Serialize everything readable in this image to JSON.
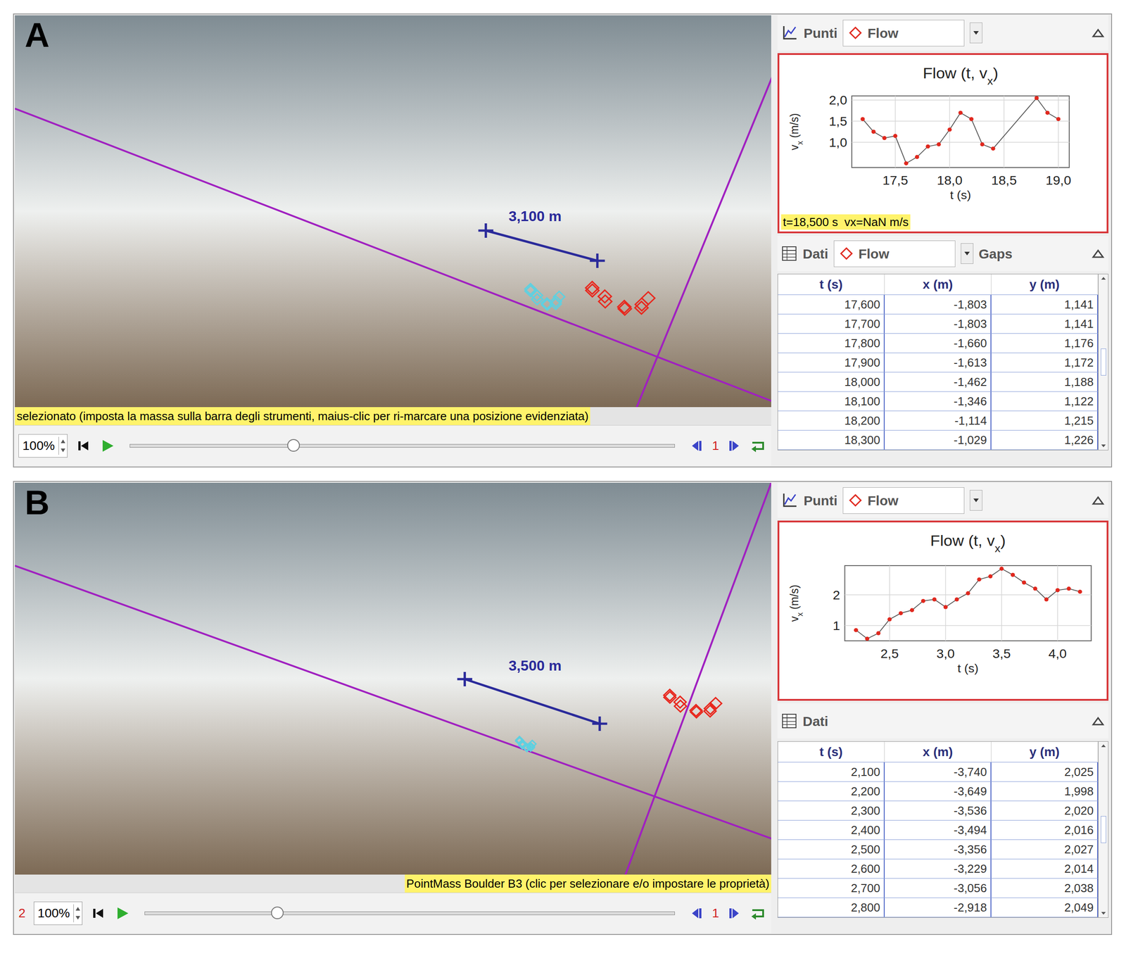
{
  "panels": [
    {
      "letter": "A",
      "video": {
        "tape_label": "3,100 m",
        "status": "selezionato (imposta la massa sulla barra degli strumenti, maius-clic per ri-marcare una posizione evidenziata)"
      },
      "controls": {
        "zoom": "100%",
        "frame": "1",
        "level": 0.3
      },
      "plot": {
        "view": "Punti",
        "track": "Flow",
        "title": "Flow (t, v",
        "title_sub": "x",
        "title_end": ")",
        "y_label": "v",
        "y_label_sub": "x",
        "y_label_end": " (m/s)",
        "x_label": "t (s)",
        "x_ticks": [
          {
            "label": "17,5",
            "value": 17.5
          },
          {
            "label": "18,0",
            "value": 18.0
          },
          {
            "label": "18,5",
            "value": 18.5
          },
          {
            "label": "19,0",
            "value": 19.0
          }
        ],
        "y_ticks": [
          {
            "label": "2,0",
            "value": 2.0
          },
          {
            "label": "1,5",
            "value": 1.5
          },
          {
            "label": "1,0",
            "value": 1.0
          }
        ],
        "series": [
          {
            "name": "Flow",
            "points": [
              [
                17.2,
                1.55
              ],
              [
                17.3,
                1.25
              ],
              [
                17.4,
                1.1
              ],
              [
                17.5,
                1.15
              ],
              [
                17.6,
                0.5
              ],
              [
                17.7,
                0.65
              ],
              [
                17.8,
                0.9
              ],
              [
                17.9,
                0.95
              ],
              [
                18.0,
                1.3
              ],
              [
                18.1,
                1.7
              ],
              [
                18.2,
                1.55
              ],
              [
                18.3,
                0.95
              ],
              [
                18.4,
                0.85
              ],
              [
                18.8,
                2.05
              ],
              [
                18.9,
                1.7
              ],
              [
                19.0,
                1.55
              ]
            ]
          }
        ],
        "readout": "t=18,500 s  vx=NaN m/s"
      },
      "table": {
        "label": "Dati",
        "track": "Flow",
        "extra": "Gaps",
        "columns": [
          "t (s)",
          "x (m)",
          "y (m)"
        ],
        "rows": [
          [
            "17,600",
            "-1,803",
            "1,141"
          ],
          [
            "17,700",
            "-1,803",
            "1,141"
          ],
          [
            "17,800",
            "-1,660",
            "1,176"
          ],
          [
            "17,900",
            "-1,613",
            "1,172"
          ],
          [
            "18,000",
            "-1,462",
            "1,188"
          ],
          [
            "18,100",
            "-1,346",
            "1,122"
          ],
          [
            "18,200",
            "-1,114",
            "1,215"
          ],
          [
            "18,300",
            "-1,029",
            "1,226"
          ]
        ]
      }
    },
    {
      "letter": "B",
      "video": {
        "tape_label": "3,500 m",
        "status": "PointMass Boulder B3 (clic per selezionare e/o impostare le proprietà)"
      },
      "controls": {
        "prefix": "2",
        "zoom": "100%",
        "frame": "1",
        "level": 0.25
      },
      "plot": {
        "view": "Punti",
        "track": "Flow",
        "title": "Flow (t, v",
        "title_sub": "x",
        "title_end": ")",
        "y_label": "v",
        "y_label_sub": "x",
        "y_label_end": " (m/s)",
        "x_label": "t (s)",
        "x_ticks": [
          {
            "label": "2,5",
            "value": 2.5
          },
          {
            "label": "3,0",
            "value": 3.0
          },
          {
            "label": "3,5",
            "value": 3.5
          },
          {
            "label": "4,0",
            "value": 4.0
          }
        ],
        "y_ticks": [
          {
            "label": "2",
            "value": 2
          },
          {
            "label": "1",
            "value": 1
          }
        ],
        "series": [
          {
            "name": "Flow",
            "points": [
              [
                2.2,
                0.85
              ],
              [
                2.3,
                0.57
              ],
              [
                2.4,
                0.75
              ],
              [
                2.5,
                1.2
              ],
              [
                2.6,
                1.4
              ],
              [
                2.7,
                1.5
              ],
              [
                2.8,
                1.8
              ],
              [
                2.9,
                1.85
              ],
              [
                3.0,
                1.6
              ],
              [
                3.1,
                1.85
              ],
              [
                3.2,
                2.05
              ],
              [
                3.3,
                2.5
              ],
              [
                3.4,
                2.6
              ],
              [
                3.5,
                2.85
              ],
              [
                3.6,
                2.65
              ],
              [
                3.7,
                2.4
              ],
              [
                3.8,
                2.2
              ],
              [
                3.9,
                1.85
              ],
              [
                4.0,
                2.15
              ],
              [
                4.1,
                2.2
              ],
              [
                4.2,
                2.1
              ]
            ]
          }
        ]
      },
      "table": {
        "label": "Dati",
        "columns": [
          "t (s)",
          "x (m)",
          "y (m)"
        ],
        "rows": [
          [
            "2,100",
            "-3,740",
            "2,025"
          ],
          [
            "2,200",
            "-3,649",
            "1,998"
          ],
          [
            "2,300",
            "-3,536",
            "2,020"
          ],
          [
            "2,400",
            "-3,494",
            "2,016"
          ],
          [
            "2,500",
            "-3,356",
            "2,027"
          ],
          [
            "2,600",
            "-3,229",
            "2,014"
          ],
          [
            "2,700",
            "-3,056",
            "2,038"
          ],
          [
            "2,800",
            "-2,918",
            "2,049"
          ]
        ]
      }
    }
  ]
}
